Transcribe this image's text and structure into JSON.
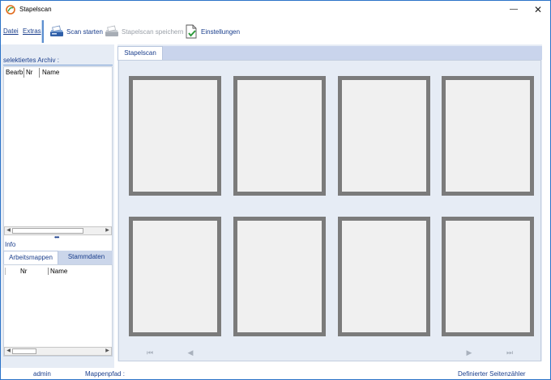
{
  "window": {
    "title": "Stapelscan",
    "minimize_glyph": "—",
    "close_glyph": "✕"
  },
  "menu": {
    "datei": "Datei",
    "extras": "Extras"
  },
  "toolbar": {
    "scan_start": "Scan starten",
    "save_batch": "Stapelscan speichern",
    "settings": "Einstellungen"
  },
  "left": {
    "archive_header": "selektiertes Archiv :",
    "archive_columns": [
      "Bearb.",
      "Nr",
      "Name"
    ],
    "splitter": "•••",
    "info_label": "Info",
    "tabs": {
      "arbeitsmappen": "Arbeitsmappen",
      "stammdaten": "Stammdaten"
    },
    "mappen_columns": [
      "Nr",
      "Name"
    ]
  },
  "right": {
    "tab": "Stapelscan",
    "nav": {
      "first": "⏮",
      "prev": "◀",
      "next": "▶",
      "last": "⏭"
    }
  },
  "status": {
    "user": "admin",
    "mappenpfad": "Mappenpfad :",
    "page_counter": "Definierter Seitenzähler"
  },
  "colors": {
    "accent": "#1a3e8c",
    "frame": "#2b73c8",
    "page_border": "#7b7b7b"
  }
}
